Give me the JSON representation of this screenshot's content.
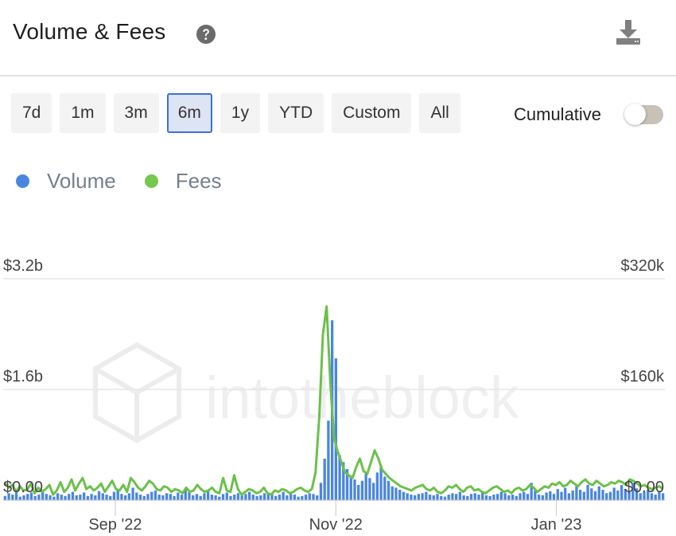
{
  "header": {
    "title": "Volume & Fees",
    "help_icon": "question-circle-icon",
    "download_icon": "download-icon"
  },
  "ranges": [
    {
      "label": "7d",
      "active": false
    },
    {
      "label": "1m",
      "active": false
    },
    {
      "label": "3m",
      "active": false
    },
    {
      "label": "6m",
      "active": true
    },
    {
      "label": "1y",
      "active": false
    },
    {
      "label": "YTD",
      "active": false
    },
    {
      "label": "Custom",
      "active": false
    },
    {
      "label": "All",
      "active": false
    }
  ],
  "cumulative": {
    "label": "Cumulative",
    "on": false
  },
  "legend": [
    {
      "label": "Volume",
      "color": "#4a86e0"
    },
    {
      "label": "Fees",
      "color": "#74c74f"
    }
  ],
  "colors": {
    "volume": "#4a86e0",
    "fees": "#6cc04a",
    "grid": "#e6e6e6"
  },
  "watermark": "intotheblock",
  "chart_data": {
    "type": "bar",
    "x_start": "2022-08-01",
    "x_end": "2023-01-31",
    "x_ticks": [
      {
        "label": "Sep '22",
        "date": "2022-09-01"
      },
      {
        "label": "Nov '22",
        "date": "2022-11-01"
      },
      {
        "label": "Jan '23",
        "date": "2023-01-01"
      }
    ],
    "y_left": {
      "ticks": [
        "$0.00",
        "$1.6b",
        "$3.2b"
      ],
      "ylim": [
        0,
        3.2
      ],
      "unit": "billions USD"
    },
    "y_right": {
      "ticks": [
        "$0.00",
        "$160k",
        "$320k"
      ],
      "ylim": [
        0,
        320
      ],
      "unit": "thousands USD"
    },
    "series": [
      {
        "name": "Volume",
        "type": "bar",
        "axis": "left",
        "values": [
          0.06,
          0.1,
          0.08,
          0.12,
          0.05,
          0.07,
          0.09,
          0.11,
          0.06,
          0.08,
          0.13,
          0.09,
          0.07,
          0.05,
          0.1,
          0.08,
          0.06,
          0.09,
          0.12,
          0.07,
          0.08,
          0.11,
          0.06,
          0.09,
          0.07,
          0.13,
          0.1,
          0.08,
          0.06,
          0.12,
          0.15,
          0.09,
          0.07,
          0.1,
          0.18,
          0.11,
          0.08,
          0.06,
          0.09,
          0.12,
          0.14,
          0.08,
          0.07,
          0.1,
          0.09,
          0.06,
          0.11,
          0.08,
          0.15,
          0.12,
          0.07,
          0.09,
          0.06,
          0.1,
          0.13,
          0.08,
          0.07,
          0.05,
          0.09,
          0.11,
          0.06,
          0.08,
          0.1,
          0.07,
          0.09,
          0.12,
          0.08,
          0.06,
          0.07,
          0.1,
          0.11,
          0.09,
          0.06,
          0.08,
          0.12,
          0.07,
          0.09,
          0.08,
          0.05,
          0.06,
          0.08,
          0.1,
          0.09,
          0.07,
          0.25,
          0.6,
          1.15,
          2.6,
          2.05,
          0.65,
          0.55,
          0.45,
          0.35,
          0.3,
          0.22,
          0.28,
          0.38,
          0.32,
          0.25,
          0.4,
          0.5,
          0.34,
          0.28,
          0.2,
          0.18,
          0.15,
          0.12,
          0.1,
          0.08,
          0.07,
          0.09,
          0.1,
          0.12,
          0.08,
          0.07,
          0.09,
          0.06,
          0.05,
          0.08,
          0.1,
          0.09,
          0.12,
          0.07,
          0.06,
          0.09,
          0.1,
          0.08,
          0.11,
          0.07,
          0.06,
          0.08,
          0.09,
          0.12,
          0.1,
          0.07,
          0.08,
          0.06,
          0.1,
          0.12,
          0.09,
          0.25,
          0.14,
          0.08,
          0.07,
          0.11,
          0.13,
          0.09,
          0.16,
          0.12,
          0.18,
          0.1,
          0.14,
          0.2,
          0.15,
          0.12,
          0.22,
          0.17,
          0.13,
          0.2,
          0.15,
          0.1,
          0.12,
          0.18,
          0.14,
          0.22,
          0.16,
          0.12,
          0.25,
          0.17,
          0.1,
          0.12,
          0.15,
          0.1,
          0.08,
          0.12,
          0.1
        ]
      },
      {
        "name": "Fees",
        "type": "line",
        "axis": "right",
        "values": [
          25,
          18,
          22,
          12,
          20,
          14,
          15,
          24,
          10,
          18,
          12,
          16,
          22,
          8,
          14,
          26,
          12,
          18,
          30,
          14,
          24,
          32,
          16,
          20,
          14,
          18,
          24,
          12,
          20,
          28,
          16,
          14,
          22,
          12,
          32,
          26,
          18,
          14,
          20,
          28,
          24,
          16,
          14,
          20,
          18,
          12,
          16,
          14,
          10,
          18,
          12,
          14,
          22,
          16,
          12,
          14,
          18,
          12,
          10,
          32,
          14,
          12,
          36,
          16,
          8,
          12,
          16,
          14,
          10,
          12,
          18,
          10,
          8,
          14,
          12,
          16,
          14,
          10,
          12,
          16,
          18,
          14,
          12,
          16,
          40,
          120,
          240,
          280,
          170,
          90,
          70,
          55,
          40,
          36,
          32,
          48,
          60,
          42,
          38,
          55,
          72,
          60,
          44,
          38,
          32,
          28,
          24,
          20,
          18,
          16,
          14,
          18,
          20,
          22,
          16,
          14,
          18,
          12,
          10,
          14,
          20,
          18,
          22,
          16,
          12,
          18,
          20,
          14,
          16,
          12,
          10,
          14,
          18,
          20,
          16,
          12,
          14,
          10,
          16,
          18,
          14,
          16,
          22,
          18,
          12,
          16,
          20,
          18,
          24,
          22,
          26,
          20,
          22,
          28,
          24,
          20,
          26,
          30,
          24,
          22,
          28,
          24,
          20,
          22,
          26,
          24,
          28,
          26,
          22,
          30,
          28,
          24,
          20,
          22,
          18,
          16,
          18,
          20,
          16
        ]
      }
    ]
  }
}
